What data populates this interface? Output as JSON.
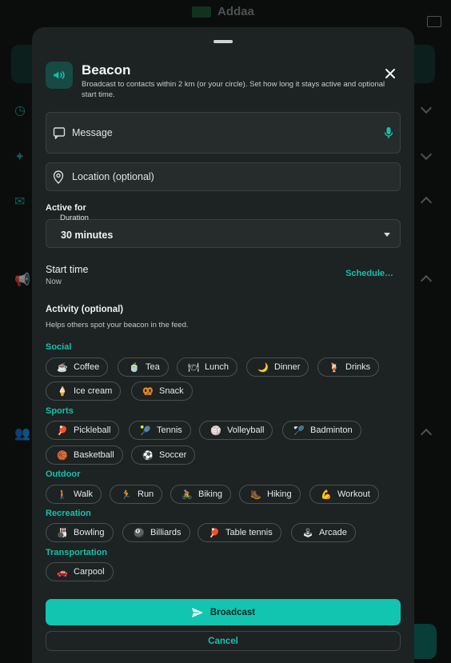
{
  "app": {
    "title": "Addaa"
  },
  "sheet": {
    "title": "Beacon",
    "subtitle": "Broadcast to contacts within 2 km (or your circle). Set how long it stays active and optional start time.",
    "message_placeholder": "Message",
    "location_placeholder": "Location (optional)",
    "active_for_label": "Active for",
    "duration_caption": "Duration",
    "duration_value": "30 minutes",
    "start_time_label": "Start time",
    "start_time_value": "Now",
    "schedule_label": "Schedule…",
    "activity_title": "Activity (optional)",
    "activity_help": "Helps others spot your beacon in the feed.",
    "broadcast_label": "Broadcast",
    "cancel_label": "Cancel"
  },
  "categories": [
    {
      "name": "Social",
      "chips": [
        {
          "emoji": "☕",
          "label": "Coffee"
        },
        {
          "emoji": "🍵",
          "label": "Tea"
        },
        {
          "emoji": "🍽",
          "label": "Lunch"
        },
        {
          "emoji": "🌙",
          "label": "Dinner"
        },
        {
          "emoji": "🍹",
          "label": "Drinks"
        },
        {
          "emoji": "🍦",
          "label": "Ice cream"
        },
        {
          "emoji": "🥨",
          "label": "Snack"
        }
      ]
    },
    {
      "name": "Sports",
      "chips": [
        {
          "emoji": "🏓",
          "label": "Pickleball"
        },
        {
          "emoji": "🎾",
          "label": "Tennis"
        },
        {
          "emoji": "🏐",
          "label": "Volleyball"
        },
        {
          "emoji": "🏸",
          "label": "Badminton"
        },
        {
          "emoji": "🏀",
          "label": "Basketball"
        },
        {
          "emoji": "⚽",
          "label": "Soccer"
        }
      ]
    },
    {
      "name": "Outdoor",
      "chips": [
        {
          "emoji": "🚶",
          "label": "Walk"
        },
        {
          "emoji": "🏃",
          "label": "Run"
        },
        {
          "emoji": "🚴",
          "label": "Biking"
        },
        {
          "emoji": "🥾",
          "label": "Hiking"
        },
        {
          "emoji": "💪",
          "label": "Workout"
        }
      ]
    },
    {
      "name": "Recreation",
      "chips": [
        {
          "emoji": "🎳",
          "label": "Bowling"
        },
        {
          "emoji": "🎱",
          "label": "Billiards"
        },
        {
          "emoji": "🏓",
          "label": "Table tennis"
        },
        {
          "emoji": "🕹",
          "label": "Arcade"
        }
      ]
    },
    {
      "name": "Transportation",
      "chips": [
        {
          "emoji": "🚗",
          "label": "Carpool"
        }
      ]
    }
  ],
  "colors": {
    "accent": "#12c2ad",
    "sheet": "#1d2222",
    "field": "#262b2b"
  }
}
